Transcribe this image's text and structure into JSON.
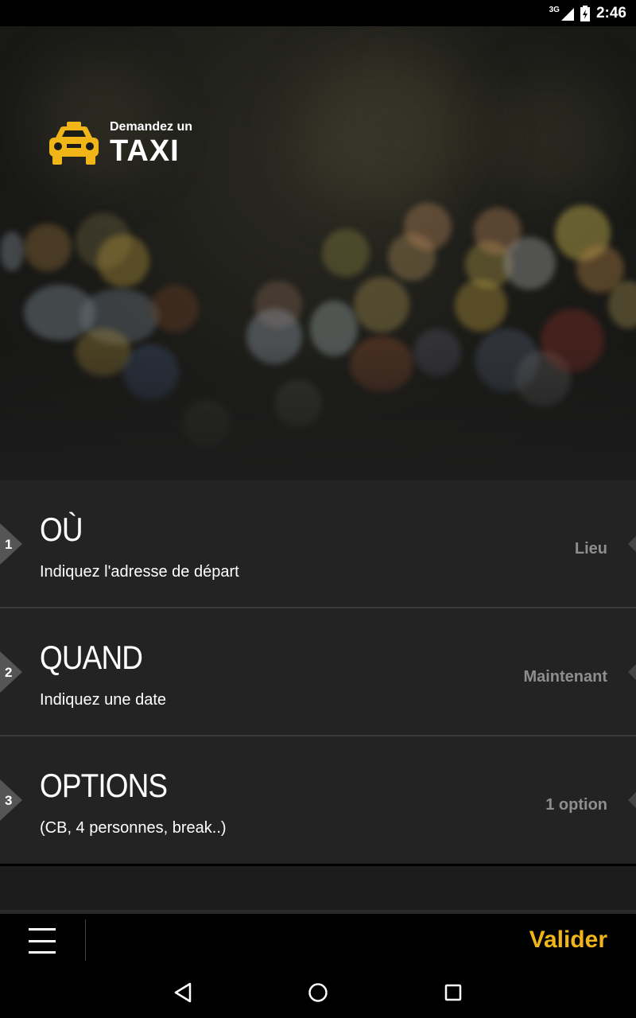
{
  "status_bar": {
    "network_label": "3G",
    "time": "2:46"
  },
  "header": {
    "logo_subtitle": "Demandez un",
    "logo_title": "TAXI",
    "logo_icon": "taxi-icon",
    "accent_color": "#f0b617"
  },
  "steps": [
    {
      "number": "1",
      "title": "OÙ",
      "subtitle": "Indiquez l'adresse de départ",
      "value": "Lieu"
    },
    {
      "number": "2",
      "title": "QUAND",
      "subtitle": "Indiquez une date",
      "value": "Maintenant"
    },
    {
      "number": "3",
      "title": "OPTIONS",
      "subtitle": "(CB, 4 personnes, break..)",
      "value": "1 option"
    }
  ],
  "bottom_bar": {
    "menu_icon": "hamburger-menu-icon",
    "validate_label": "Valider"
  },
  "nav_bar": {
    "back_icon": "back-icon",
    "home_icon": "home-icon",
    "recents_icon": "recents-icon"
  }
}
